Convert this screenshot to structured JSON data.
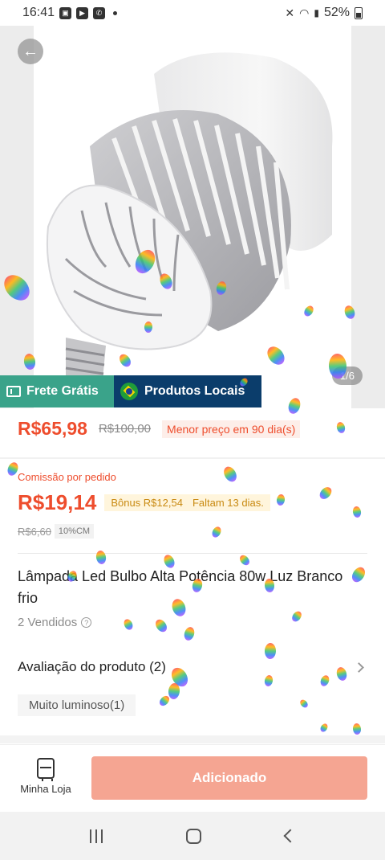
{
  "status_bar": {
    "time": "16:41",
    "battery": "52%"
  },
  "gallery": {
    "counter": "1/6"
  },
  "badges": {
    "free_shipping": "Frete Grátis",
    "local_products": "Produtos Locais"
  },
  "price": {
    "current": "R$65,98",
    "original": "R$100,00",
    "tag": "Menor preço em 90 dia(s)"
  },
  "commission": {
    "label": "Comissão por pedido",
    "value": "R$19,14",
    "bonus": "Bônus R$12,54",
    "remaining": "Faltam 13 dias.",
    "old_value": "R$6,60",
    "cm_tag": "10%CM"
  },
  "product": {
    "title": "Lâmpada Led Bulbo Alta Potência 80w Luz Branco frio",
    "sold": "2 Vendidos"
  },
  "rating": {
    "label": "Avaliação do produto (2)",
    "chip": "Muito luminoso(1)"
  },
  "bottom": {
    "store_label": "Minha Loja",
    "add_button": "Adicionado"
  },
  "colors": {
    "accent": "#ee4d2d",
    "free_shipping": "#3aa38a",
    "local": "#0b3d6b",
    "added_button": "#f5a592"
  }
}
